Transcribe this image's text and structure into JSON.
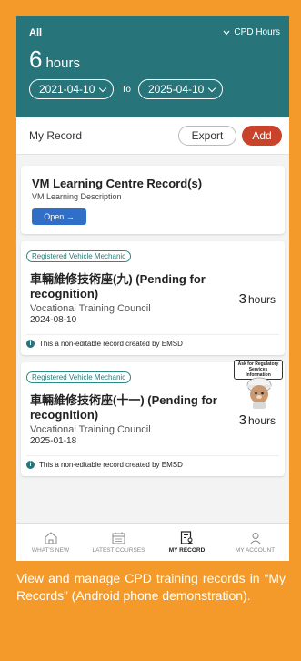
{
  "header": {
    "filter": "All",
    "cpd_label": "CPD Hours",
    "hours_value": "6",
    "hours_unit": "hours",
    "date_from": "2021-04-10",
    "date_to_label": "To",
    "date_to": "2025-04-10"
  },
  "record_bar": {
    "title": "My Record",
    "export_label": "Export",
    "add_label": "Add"
  },
  "vm_card": {
    "title": "VM Learning Centre Record(s)",
    "description": "VM Learning Description",
    "open_label": "Open →"
  },
  "records": [
    {
      "tag": "Registered Vehicle Mechanic",
      "title": "車輛維修技術座(九) (Pending for recognition)",
      "org": "Vocational Training Council",
      "date": "2024-08-10",
      "hours_value": "3",
      "hours_unit": "hours",
      "note": "This a non-editable record created by EMSD"
    },
    {
      "tag": "Registered Vehicle Mechanic",
      "title": "車輛維修技術座(十一) (Pending for recognition)",
      "org": "Vocational Training Council",
      "date": "2025-01-18",
      "hours_value": "3",
      "hours_unit": "hours",
      "note": "This a non-editable record created by EMSD"
    }
  ],
  "mascot_bubble": "Ask for Regulatory Services Information",
  "nav": {
    "items": [
      {
        "label": "WHAT'S NEW",
        "icon": "home-icon"
      },
      {
        "label": "LATEST COURSES",
        "icon": "calendar-icon"
      },
      {
        "label": "MY RECORD",
        "icon": "record-icon"
      },
      {
        "label": "MY ACCOUNT",
        "icon": "user-icon"
      }
    ]
  },
  "caption": "View and manage CPD training records in “My Records” (Android phone demonstration).",
  "colors": {
    "background": "#f39a2a",
    "header": "#27757a",
    "add_button": "#c9422a",
    "open_button": "#2f6fc7"
  }
}
